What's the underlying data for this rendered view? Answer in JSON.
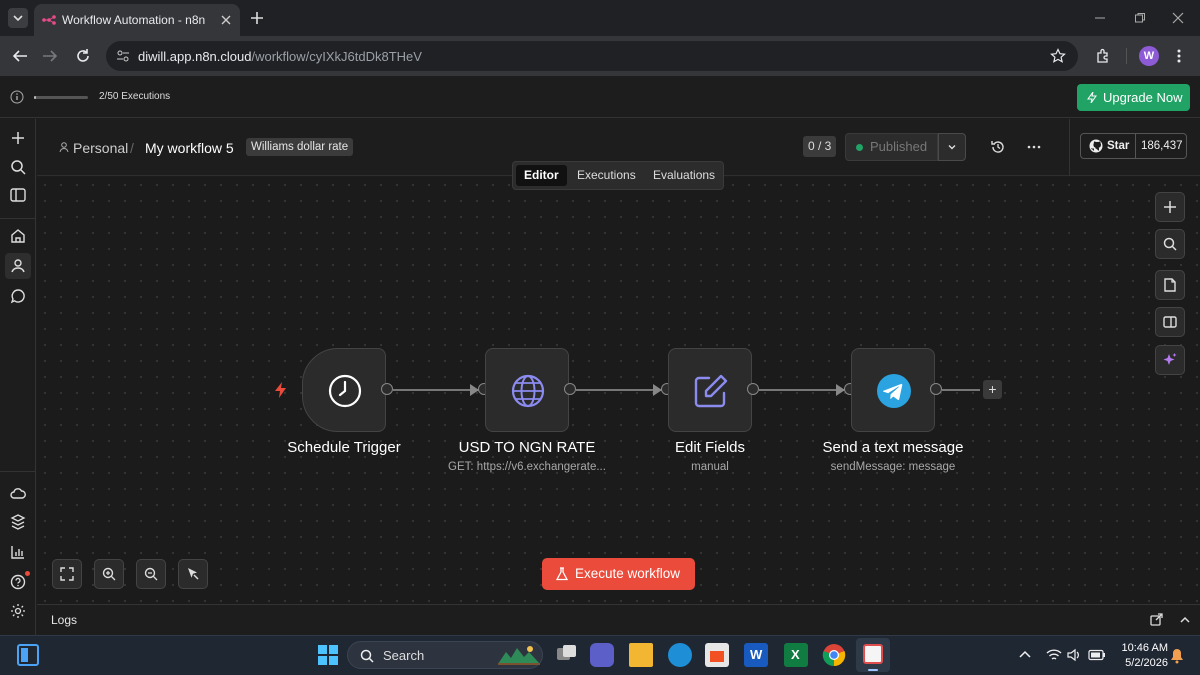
{
  "browser": {
    "tab_title": "Workflow Automation - n8n",
    "url_host": "diwill.app.n8n.cloud",
    "url_path": "/workflow/cyIXkJ6tdDk8THeV",
    "profile_initial": "W"
  },
  "banner": {
    "executions_text": "2/50 Executions",
    "executions_used": 2,
    "executions_limit": 50,
    "upgrade_label": "Upgrade Now"
  },
  "header": {
    "project": "Personal",
    "separator": "/",
    "workflow_name": "My workflow 5",
    "tag": "Williams dollar rate",
    "version_count": "0 / 3",
    "publish_status": "Published",
    "github_star_label": "Star",
    "github_star_count": "186,437"
  },
  "view_tabs": [
    {
      "label": "Editor",
      "active": true
    },
    {
      "label": "Executions",
      "active": false
    },
    {
      "label": "Evaluations",
      "active": false
    }
  ],
  "nodes": [
    {
      "title": "Schedule Trigger",
      "subtitle": "",
      "icon": "clock-icon"
    },
    {
      "title": "USD TO NGN RATE",
      "subtitle": "GET: https://v6.exchangerate...",
      "icon": "globe-icon"
    },
    {
      "title": "Edit Fields",
      "subtitle": "manual",
      "icon": "pencil-icon"
    },
    {
      "title": "Send a text message",
      "subtitle": "sendMessage: message",
      "icon": "telegram-icon"
    }
  ],
  "execute_label": "Execute workflow",
  "logs_label": "Logs",
  "taskbar": {
    "search_label": "Search",
    "time": "10:46 AM",
    "date": "5/2/2026"
  },
  "colors": {
    "accent": "#ea4b3a",
    "upgrade": "#21a366",
    "icon_purple": "#8b8bf0",
    "telegram": "#2aa3e0"
  }
}
